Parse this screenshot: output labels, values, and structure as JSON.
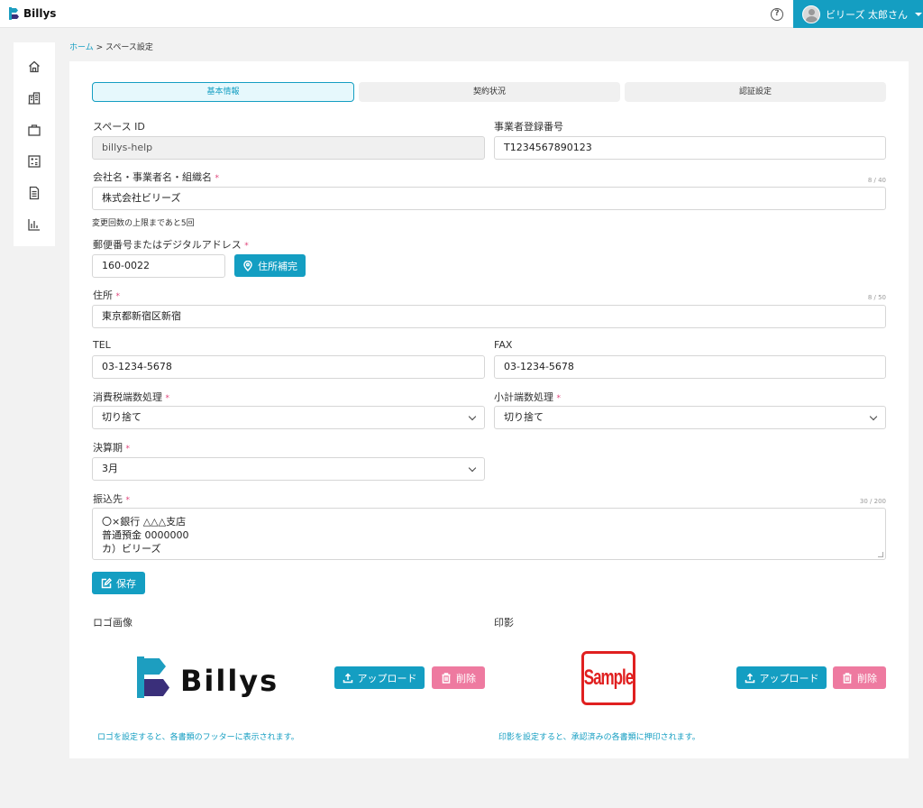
{
  "app": {
    "name": "Billys"
  },
  "header": {
    "user_name": "ビリーズ 太郎さん",
    "help_icon": "question-circle-icon"
  },
  "sidebar": {
    "items": [
      {
        "icon": "home-icon"
      },
      {
        "icon": "building-icon"
      },
      {
        "icon": "briefcase-icon"
      },
      {
        "icon": "calculator-icon"
      },
      {
        "icon": "document-icon"
      },
      {
        "icon": "chart-icon"
      }
    ]
  },
  "breadcrumb": {
    "home": "ホーム",
    "separator": " > ",
    "current": "スペース設定"
  },
  "tabs": [
    {
      "label": "基本情報",
      "active": true
    },
    {
      "label": "契約状況",
      "active": false
    },
    {
      "label": "認証設定",
      "active": false
    }
  ],
  "form": {
    "space_id": {
      "label": "スペース ID",
      "value": "billys-help"
    },
    "registration_no": {
      "label": "事業者登録番号",
      "value": "T1234567890123"
    },
    "company_name": {
      "label": "会社名・事業者名・組織名",
      "required": "*",
      "counter": "8 / 40",
      "value": "株式会社ビリーズ",
      "hint": "変更回数の上限まであと5回"
    },
    "postal": {
      "label": "郵便番号またはデジタルアドレス",
      "required": "*",
      "value": "160-0022",
      "button": "住所補完"
    },
    "address": {
      "label": "住所",
      "required": "*",
      "counter": "8 / 50",
      "value": "東京都新宿区新宿"
    },
    "tel": {
      "label": "TEL",
      "value": "03-1234-5678"
    },
    "fax": {
      "label": "FAX",
      "value": "03-1234-5678"
    },
    "tax_rounding": {
      "label": "消費税端数処理",
      "required": "*",
      "value": "切り捨て"
    },
    "subtotal_rounding": {
      "label": "小計端数処理",
      "required": "*",
      "value": "切り捨て"
    },
    "fiscal_month": {
      "label": "決算期",
      "required": "*",
      "value": "3月"
    },
    "bank": {
      "label": "振込先",
      "required": "*",
      "counter": "30 / 200",
      "lines": [
        "〇×銀行 △△△支店",
        "普通預金 0000000",
        "カ）ビリーズ"
      ]
    },
    "save_button": "保存"
  },
  "logo_section": {
    "label": "ロゴ画像",
    "logo_text": "Billys",
    "upload": "アップロード",
    "delete": "削除",
    "note": "ロゴを設定すると、各書類のフッターに表示されます。"
  },
  "stamp_section": {
    "label": "印影",
    "stamp_text": "Sample",
    "upload": "アップロード",
    "delete": "削除",
    "note": "印影を設定すると、承認済みの各書類に押印されます。"
  },
  "colors": {
    "accent": "#149ec2",
    "danger": "#ee7aa0",
    "required": "#e0447a"
  }
}
